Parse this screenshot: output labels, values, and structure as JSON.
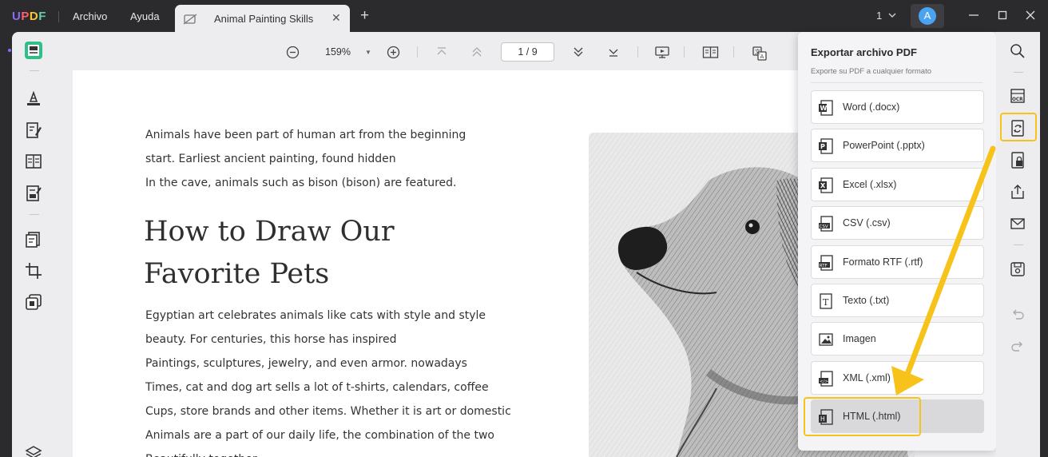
{
  "app": {
    "logo": "UPDF",
    "menu": {
      "file": "Archivo",
      "help": "Ayuda"
    },
    "tab": {
      "title": "Animal Painting Skills",
      "close": "✕"
    },
    "new_tab": "+",
    "window_count": "1",
    "avatar_letter": "A"
  },
  "toolbar": {
    "zoom_level": "159%",
    "page_indicator": "1  /  9"
  },
  "document": {
    "intro_lines": [
      "Animals have been part of human art from the beginning",
      "start. Earliest ancient painting, found hidden",
      "In the cave, animals such as bison (bison) are featured."
    ],
    "heading_lines": [
      "How to Draw Our",
      "Favorite Pets"
    ],
    "body_lines": [
      "Egyptian art celebrates animals like cats with style and style",
      "beauty. For centuries, this horse has inspired",
      "Paintings, sculptures, jewelry, and even armor. nowadays",
      "Times, cat and dog art sells a lot of t-shirts, calendars, coffee",
      "Cups, store brands and other items. Whether it is art or domestic",
      "Animals are a part of our daily life, the combination of the two",
      "Beautifully together."
    ]
  },
  "export_panel": {
    "title": "Exportar archivo PDF",
    "subtitle": "Exporte su PDF a cualquier formato",
    "options": [
      {
        "label": "Word (.docx)",
        "icon": "word-file-icon"
      },
      {
        "label": "PowerPoint (.pptx)",
        "icon": "powerpoint-file-icon"
      },
      {
        "label": "Excel (.xlsx)",
        "icon": "excel-file-icon"
      },
      {
        "label": "CSV (.csv)",
        "icon": "csv-file-icon"
      },
      {
        "label": "Formato RTF (.rtf)",
        "icon": "rtf-file-icon"
      },
      {
        "label": "Texto (.txt)",
        "icon": "text-file-icon"
      },
      {
        "label": "Imagen",
        "icon": "image-file-icon"
      },
      {
        "label": "XML (.xml)",
        "icon": "xml-file-icon"
      },
      {
        "label": "HTML (.html)",
        "icon": "html-file-icon",
        "selected": true
      }
    ]
  },
  "colors": {
    "highlight": "#f7c31a",
    "accent": "#8b6cf6",
    "active_tool": "#2fc08a"
  }
}
